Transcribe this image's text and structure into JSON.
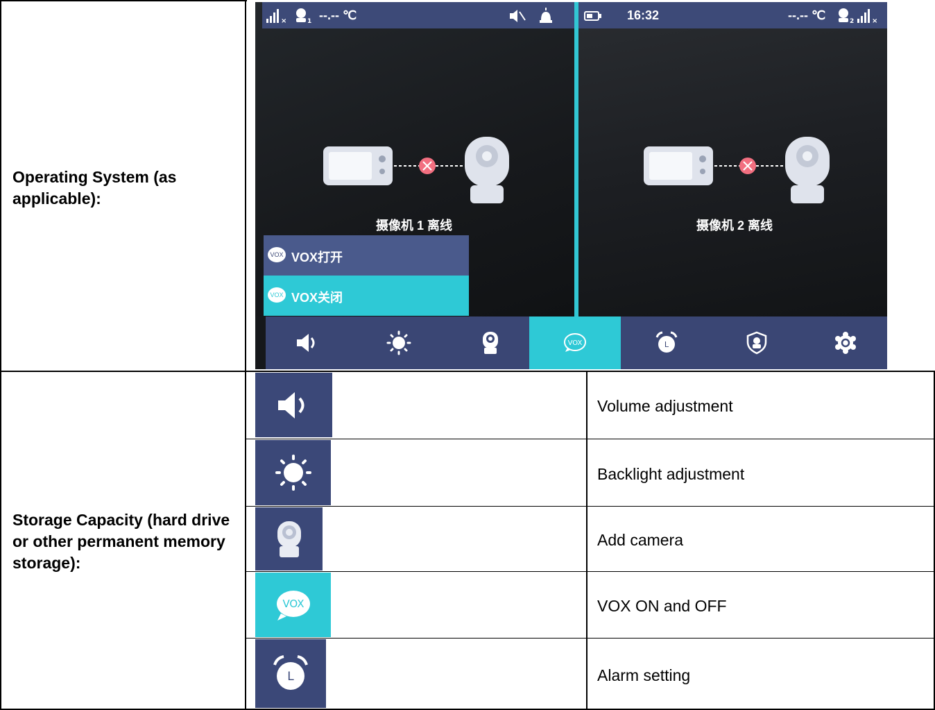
{
  "rows": [
    {
      "label": "Operating System (as applicable):"
    },
    {
      "label": "Storage Capacity (hard drive or other permanent memory storage):"
    }
  ],
  "device": {
    "left_status": {
      "temp": "--.-- ℃"
    },
    "right_status": {
      "time": "16:32",
      "temp": "--.-- ℃"
    },
    "cam1_offline": "摄像机 1 离线",
    "cam2_offline": "摄像机 2 离线",
    "vox_menu": [
      {
        "label": "VOX打开",
        "icon_text": "VOX"
      },
      {
        "label": "VOX关闭",
        "icon_text": "VOX"
      }
    ],
    "toolbar": [
      {
        "icon": "speaker-icon"
      },
      {
        "icon": "brightness-icon"
      },
      {
        "icon": "camera-icon"
      },
      {
        "icon": "vox-icon",
        "text": "VOX",
        "active": true
      },
      {
        "icon": "alarm-clock-icon"
      },
      {
        "icon": "shield-icon"
      },
      {
        "icon": "gear-icon"
      }
    ],
    "accent_color": "#2ec9d6",
    "bar_color": "#3a4674"
  },
  "functions": [
    {
      "icon": "speaker-icon",
      "desc": "Volume adjustment"
    },
    {
      "icon": "brightness-icon",
      "desc": "Backlight adjustment"
    },
    {
      "icon": "camera-icon",
      "desc": "Add camera"
    },
    {
      "icon": "vox-icon",
      "icon_text": "VOX",
      "desc": "VOX ON and OFF"
    },
    {
      "icon": "alarm-clock-icon",
      "desc": "Alarm setting"
    }
  ]
}
